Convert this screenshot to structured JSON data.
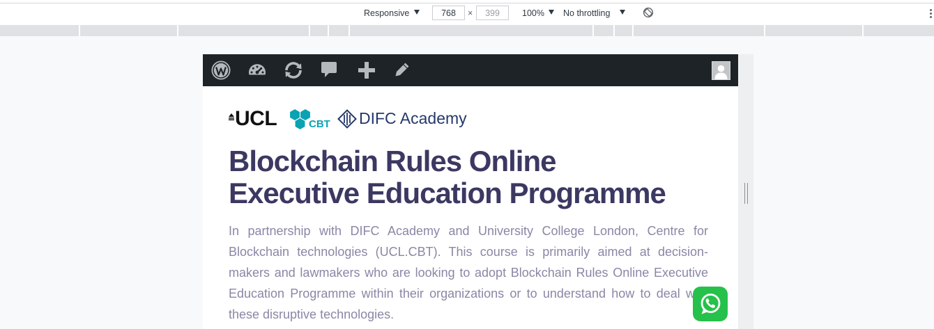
{
  "devtools": {
    "device_label": "Responsive",
    "width_value": "768",
    "dimension_separator": "×",
    "height_placeholder": "399",
    "zoom_label": "100%",
    "throttling_label": "No throttling",
    "icons": {
      "dropdown": "caret-down-icon",
      "rotate": "rotate-icon",
      "more": "more-vertical-icon"
    }
  },
  "admin_bar": {
    "icons": {
      "wordpress": "wordpress-logo-icon",
      "dashboard": "dashboard-icon",
      "updates": "updates-icon",
      "comments": "comments-icon",
      "new_content": "plus-icon",
      "edit": "pencil-icon",
      "account": "avatar-icon"
    }
  },
  "logos": {
    "ucl": "UCL",
    "cbt": "CBT",
    "difc": "DIFC Academy"
  },
  "hero": {
    "title_lines": [
      "Blockchain Rules Online",
      "Executive Education Programme"
    ],
    "paragraph_lines": [
      "In partnership with DIFC Academy and University College London, Centre for",
      "Blockchain technologies (UCL.CBT). This course is primarily aimed at decision-",
      "makers and lawmakers who are looking to adopt Blockchain Rules Online Executive",
      "Education Programme within their organizations or to understand how to deal with",
      "these disruptive technologies."
    ]
  },
  "floating": {
    "chat_icon": "whatsapp-icon"
  },
  "colors": {
    "admin_bar_bg": "#1d2327",
    "admin_icon": "#b4b9be",
    "title": "#3b3862",
    "paragraph": "#8a87a6",
    "ucl": "#111111",
    "cbt_teal": "#0aa3b3",
    "difc_navy": "#25386b",
    "whatsapp_green": "#26c14a"
  }
}
